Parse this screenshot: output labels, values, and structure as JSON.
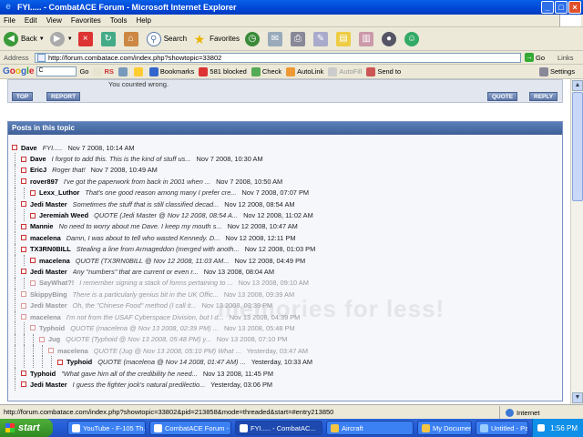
{
  "window": {
    "title": "FYI..... - CombatACE Forum - Microsoft Internet Explorer"
  },
  "menu": [
    "File",
    "Edit",
    "View",
    "Favorites",
    "Tools",
    "Help"
  ],
  "toolbar": {
    "back": "Back",
    "search": "Search",
    "favorites": "Favorites"
  },
  "address": {
    "label": "Address",
    "url": "http://forum.combatace.com/index.php?showtopic=33802",
    "go": "Go",
    "links": "Links"
  },
  "googlebar": {
    "logo": "Google",
    "search_value": "C",
    "go": "Go",
    "rs": "RS",
    "bookmarks": "Bookmarks",
    "blocked": "581 blocked",
    "check": "Check",
    "autolink": "AutoLink",
    "autofill": "AutoFill",
    "sendto": "Send to",
    "settings": "Settings"
  },
  "forum": {
    "snippet_top": "You counted wrong.",
    "btn_top": "TOP",
    "btn_report": "REPORT",
    "btn_quote": "QUOTE",
    "btn_reply": "REPLY",
    "posts_header": "Posts in this topic",
    "watermark": "memories for less!",
    "posts": [
      {
        "author": "Dave",
        "snippet": "FYI.....",
        "date": "Nov 7 2008, 10:14 AM",
        "depth": 0,
        "dim": false
      },
      {
        "author": "Dave",
        "snippet": "I forgot to add this. This is the kind of stuff us...",
        "date": "Nov 7 2008, 10:30 AM",
        "depth": 1,
        "dim": false
      },
      {
        "author": "EricJ",
        "snippet": "Roger that!",
        "date": "Nov 7 2008, 10:49 AM",
        "depth": 1,
        "dim": false
      },
      {
        "author": "rover897",
        "snippet": "I've got the paperwork from back in 2001 when ...",
        "date": "Nov 7 2008, 10:50 AM",
        "depth": 1,
        "dim": false
      },
      {
        "author": "Lexx_Luthor",
        "snippet": "That's one good reason among many I prefer cre...",
        "date": "Nov 7 2008, 07:07 PM",
        "depth": 2,
        "dim": false
      },
      {
        "author": "Jedi Master",
        "snippet": "Sometimes the stuff that is still classified decad...",
        "date": "Nov 12 2008, 08:54 AM",
        "depth": 1,
        "dim": false
      },
      {
        "author": "Jeremiah Weed",
        "snippet": "QUOTE (Jedi Master @ Nov 12 2008, 08:54 A...",
        "date": "Nov 12 2008, 11:02 AM",
        "depth": 2,
        "dim": false
      },
      {
        "author": "Mannie",
        "snippet": "No need to worry about me Dave. I keep my mouth s...",
        "date": "Nov 12 2008, 10:47 AM",
        "depth": 1,
        "dim": false
      },
      {
        "author": "macelena",
        "snippet": "Damn, I was about to tell who wasted Kennedy. D...",
        "date": "Nov 12 2008, 12:11 PM",
        "depth": 1,
        "dim": false
      },
      {
        "author": "TX3RN0BILL",
        "snippet": "Stealing a line from Armageddon (merged with anoth...",
        "date": "Nov 12 2008, 01:03 PM",
        "depth": 1,
        "dim": false
      },
      {
        "author": "macelena",
        "snippet": "QUOTE (TX3RN0BILL @ Nov 12 2008, 11:03 AM...",
        "date": "Nov 12 2008, 04:49 PM",
        "depth": 2,
        "dim": false
      },
      {
        "author": "Jedi Master",
        "snippet": "Any \"numbers\" that are current or even r...",
        "date": "Nov 13 2008, 08:04 AM",
        "depth": 1,
        "dim": false
      },
      {
        "author": "SayWhat?!",
        "snippet": "I remember signing a stack of forms pertaining to ...",
        "date": "Nov 13 2008, 09:10 AM",
        "depth": 2,
        "dim": true
      },
      {
        "author": "SkippyBing",
        "snippet": "There is a particularly genius bit in the UK Offic...",
        "date": "Nov 13 2008, 09:39 AM",
        "depth": 1,
        "dim": true
      },
      {
        "author": "Jedi Master",
        "snippet": "Oh, the \"Chinese Food\" method (I call it...",
        "date": "Nov 13 2008, 03:39 PM",
        "depth": 1,
        "dim": true
      },
      {
        "author": "macelena",
        "snippet": "I'm not from the USAF Cyberspace Division, but I d...",
        "date": "Nov 13 2008, 04:39 PM",
        "depth": 1,
        "dim": true
      },
      {
        "author": "Typhoid",
        "snippet": "QUOTE (macelena @ Nov 13 2008, 02:39 PM) ...",
        "date": "Nov 13 2008, 05:48 PM",
        "depth": 2,
        "dim": true
      },
      {
        "author": "Jug",
        "snippet": "QUOTE (Typhoid @ Nov 13 2008, 05:48 PM) y...",
        "date": "Nov 13 2008, 07:10 PM",
        "depth": 3,
        "dim": true
      },
      {
        "author": "macelena",
        "snippet": "QUOTE (Jug @ Nov 13 2008, 05:10 PM) What ...",
        "date": "Yesterday, 03:47 AM",
        "depth": 4,
        "dim": true
      },
      {
        "author": "Typhoid",
        "snippet": "QUOTE (macelena @ Nov 14 2008, 01:47 AM) ...",
        "date": "Yesterday, 10:33 AM",
        "depth": 5,
        "dim": false
      },
      {
        "author": "Typhoid",
        "snippet": "\"What gave him all of the credibility he need...",
        "date": "Nov 13 2008, 11:45 PM",
        "depth": 1,
        "dim": false
      },
      {
        "author": "Jedi Master",
        "snippet": "I guess the fighter jock's natural predilectio...",
        "date": "Yesterday, 03:06 PM",
        "depth": 1,
        "dim": false
      }
    ]
  },
  "status": {
    "url": "http://forum.combatace.com/index.php?showtopic=33802&pid=213858&mode=threaded&start=#entry213850",
    "zone": "Internet"
  },
  "taskbar": {
    "start": "start",
    "tasks": [
      "YouTube - F-105 Th...",
      "CombatACE Forum - ...",
      "FYI..... - CombatAC...",
      "Aircraft",
      "My Documents",
      "Untitled - Paint"
    ],
    "clock": "1:56 PM"
  }
}
